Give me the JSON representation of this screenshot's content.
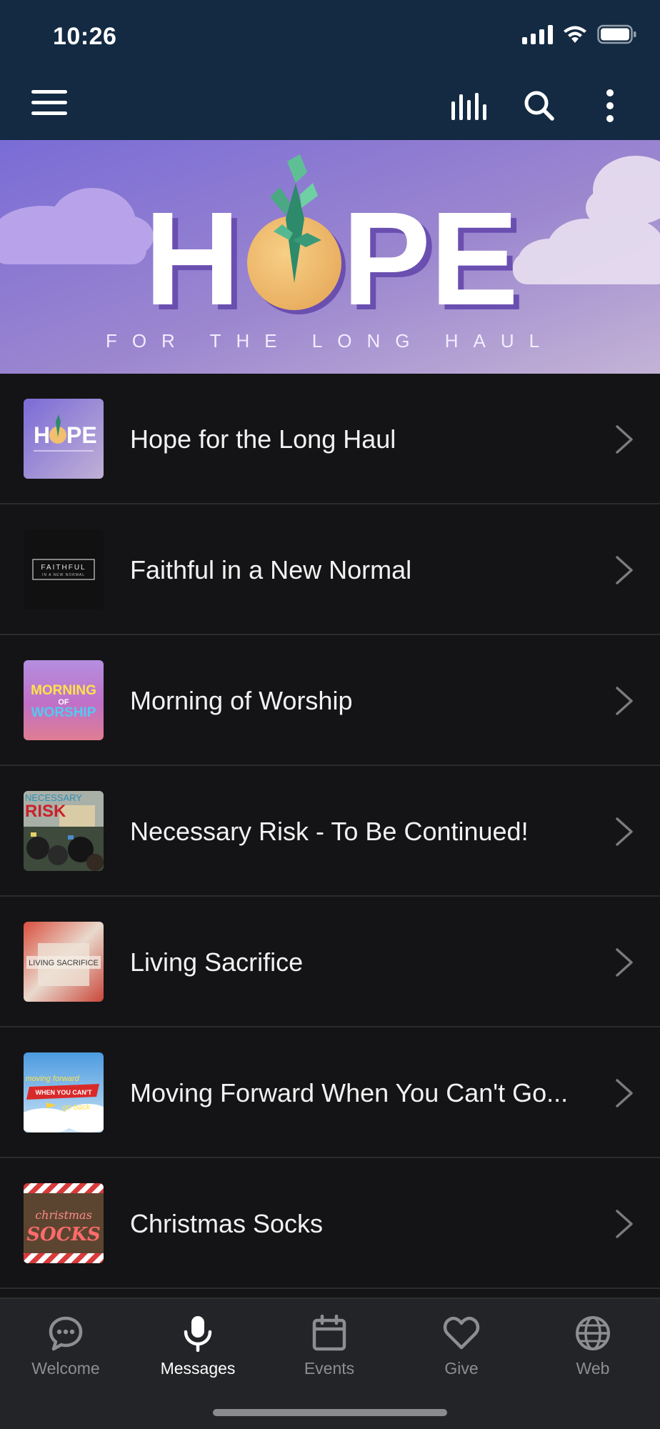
{
  "status_bar": {
    "time": "10:26"
  },
  "header": {
    "menu_icon": "hamburger-icon",
    "actions": [
      "audio-bars-icon",
      "search-icon",
      "more-vertical-icon"
    ],
    "background_color": "#132a42"
  },
  "banner": {
    "title_letters": [
      "H",
      "P",
      "E"
    ],
    "subtitle": "FOR THE LONG HAUL"
  },
  "messages": [
    {
      "title": "Hope for the Long Haul",
      "thumb": "hope"
    },
    {
      "title": "Faithful in a New Normal",
      "thumb": "faithful",
      "thumb_text": "FAITHFUL",
      "thumb_sub": "IN A NEW NORMAL"
    },
    {
      "title": "Morning of Worship",
      "thumb": "morning",
      "thumb_lines": [
        "MORNING",
        "OF",
        "WORSHIP"
      ]
    },
    {
      "title": "Necessary Risk - To Be Continued!",
      "thumb": "risk",
      "thumb_lines": [
        "NECESSARY",
        "RISK"
      ]
    },
    {
      "title": "Living Sacrifice",
      "thumb": "living",
      "thumb_text": "LIVING SACRIFICE"
    },
    {
      "title": "Moving Forward When You Can't Go...",
      "thumb": "moving",
      "thumb_lines": [
        "moving forward",
        "WHEN YOU CAN'T",
        "go back"
      ]
    },
    {
      "title": "Christmas Socks",
      "thumb": "socks",
      "thumb_lines": [
        "christmas",
        "SOCKS"
      ]
    }
  ],
  "tabs": [
    {
      "label": "Welcome",
      "icon": "chat-bubble-icon",
      "active": false
    },
    {
      "label": "Messages",
      "icon": "microphone-icon",
      "active": true
    },
    {
      "label": "Events",
      "icon": "calendar-icon",
      "active": false
    },
    {
      "label": "Give",
      "icon": "heart-icon",
      "active": false
    },
    {
      "label": "Web",
      "icon": "globe-icon",
      "active": false
    }
  ],
  "colors": {
    "list_bg": "#141416",
    "tab_inactive": "#8d8e92",
    "tab_active": "#ffffff"
  }
}
